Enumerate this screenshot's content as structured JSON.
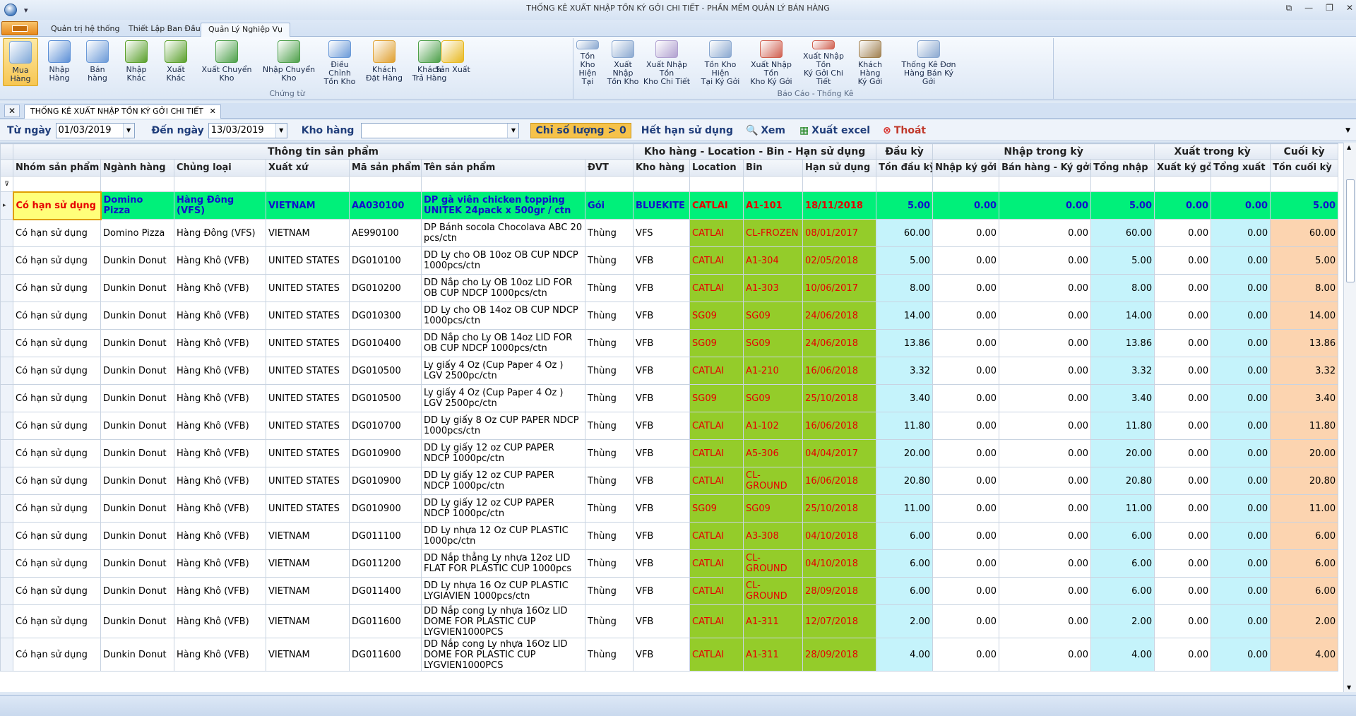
{
  "window": {
    "title": "THỐNG KÊ XUẤT NHẬP TỒN KÝ GỞI CHI TIẾT - PHẦN MỀM QUẢN LÝ BÁN HÀNG"
  },
  "ribbon_tabs": [
    "Quản trị hệ thống",
    "Thiết Lập Ban Đầu",
    "Quản Lý Nghiệp Vụ"
  ],
  "ribbon_groups": [
    {
      "label": "Chứng từ"
    },
    {
      "label": "Báo Cáo - Thống Kê"
    }
  ],
  "ribbon_buttons": [
    {
      "label": "Mua Hàng",
      "icon": "arrow-left-icon",
      "color": "#7ea7d8"
    },
    {
      "label": "Nhập Hàng",
      "icon": "arrow-down-icon",
      "color": "#5b8fd6"
    },
    {
      "label": "Bán hàng",
      "icon": "arrow-right-icon",
      "color": "#6b9ad8"
    },
    {
      "label": "Nhập Khác",
      "icon": "down-circle-icon",
      "color": "#5aa02c"
    },
    {
      "label": "Xuất Khác",
      "icon": "up-circle-icon",
      "color": "#5aa02c"
    },
    {
      "label": "Xuất Chuyển Kho",
      "icon": "refresh-icon",
      "color": "#4da04a"
    },
    {
      "label": "Nhập Chuyển Kho",
      "icon": "refresh-icon",
      "color": "#4da04a"
    },
    {
      "label": "Điều Chỉnh\nTồn Kho",
      "icon": "adjust-icon",
      "color": "#6b9ad8"
    },
    {
      "label": "Khách\nĐặt Hàng",
      "icon": "order-icon",
      "color": "#e0a030"
    },
    {
      "label": "Khách\nTrả Hàng",
      "icon": "return-icon",
      "color": "#4da04a"
    },
    {
      "label": "Sản Xuất",
      "icon": "wand-icon",
      "color": "#e8b820"
    },
    {
      "label": "Tồn Kho\nHiện Tại",
      "icon": "report-icon",
      "color": "#8aa8d0"
    },
    {
      "label": "Xuất Nhập\nTồn Kho",
      "icon": "list-icon",
      "color": "#8aa8d0"
    },
    {
      "label": "Xuất Nhập Tồn\nKho Chi Tiết",
      "icon": "grid-icon",
      "color": "#b0a0d0"
    },
    {
      "label": "Tồn Kho Hiện\nTại Ký Gởi",
      "icon": "search-doc-icon",
      "color": "#8aa8d0"
    },
    {
      "label": "Xuất Nhập Tồn\nKho Ký Gởi",
      "icon": "bar-chart-icon",
      "color": "#d06050"
    },
    {
      "label": "Xuất Nhập Tồn\nKý Gởi Chi Tiết",
      "icon": "line-chart-icon",
      "color": "#d06050"
    },
    {
      "label": "Khách Hàng\nKý Gởi",
      "icon": "customer-icon",
      "color": "#a08050"
    },
    {
      "label": "Thống Kê Đơn\nHàng Bán Ký Gởi",
      "icon": "stats-icon",
      "color": "#8aa8d0"
    }
  ],
  "doc_tab": "THỐNG KÊ XUẤT NHẬP TỒN KÝ GỞI CHI TIẾT",
  "filters": {
    "from_label": "Từ ngày",
    "from_value": "01/03/2019",
    "to_label": "Đến ngày",
    "to_value": "13/03/2019",
    "warehouse_label": "Kho hàng",
    "warehouse_value": "",
    "qty_btn": "Chỉ số lượng > 0",
    "expiry_btn": "Hết hạn sử dụng",
    "view_btn": "Xem",
    "excel_btn": "Xuất excel",
    "exit_btn": "Thoát"
  },
  "band_headers": [
    "Thông tin sản phẩm",
    "Kho hàng - Location - Bin - Hạn sử dụng",
    "Đầu kỳ",
    "Nhập trong kỳ",
    "Xuất trong kỳ",
    "Cuối kỳ"
  ],
  "columns": [
    "Nhóm sản phẩm",
    "Ngành hàng",
    "Chủng loại",
    "Xuất xứ",
    "Mã sản phẩm",
    "Tên sản phẩm",
    "ĐVT",
    "Kho hàng",
    "Location",
    "Bin",
    "Hạn sử dụng",
    "Tồn đầu kỳ",
    "Nhập ký gởi",
    "Bán hàng - Ký gởi",
    "Tổng nhập",
    "Xuất ký gởi",
    "Tổng xuất",
    "Tồn cuối kỳ"
  ],
  "rows": [
    [
      "Có hạn sử dụng",
      "Domino Pizza",
      "Hàng Đông (VFS)",
      "VIETNAM",
      "AA030100",
      "DP gà viên chicken topping UNITEK 24pack x 500gr / ctn",
      "Gói",
      "BLUEKITE",
      "CATLAI",
      "A1-101",
      "18/11/2018",
      "5.00",
      "0.00",
      "0.00",
      "5.00",
      "0.00",
      "0.00",
      "5.00"
    ],
    [
      "Có hạn sử dụng",
      "Domino Pizza",
      "Hàng Đông (VFS)",
      "VIETNAM",
      "AE990100",
      "DP Bánh socola Chocolava ABC 20 pcs/ctn",
      "Thùng",
      "VFS",
      "CATLAI",
      "CL-FROZEN",
      "08/01/2017",
      "60.00",
      "0.00",
      "0.00",
      "60.00",
      "0.00",
      "0.00",
      "60.00"
    ],
    [
      "Có hạn sử dụng",
      "Dunkin Donut",
      "Hàng Khô (VFB)",
      "UNITED STATES",
      "DG010100",
      "DD Ly cho OB 10oz OB CUP NDCP 1000pcs/ctn",
      "Thùng",
      "VFB",
      "CATLAI",
      "A1-304",
      "02/05/2018",
      "5.00",
      "0.00",
      "0.00",
      "5.00",
      "0.00",
      "0.00",
      "5.00"
    ],
    [
      "Có hạn sử dụng",
      "Dunkin Donut",
      "Hàng Khô (VFB)",
      "UNITED STATES",
      "DG010200",
      "DD Nắp cho Ly OB 10oz LID FOR OB CUP NDCP 1000pcs/ctn",
      "Thùng",
      "VFB",
      "CATLAI",
      "A1-303",
      "10/06/2017",
      "8.00",
      "0.00",
      "0.00",
      "8.00",
      "0.00",
      "0.00",
      "8.00"
    ],
    [
      "Có hạn sử dụng",
      "Dunkin Donut",
      "Hàng Khô (VFB)",
      "UNITED STATES",
      "DG010300",
      "DD Ly cho OB 14oz OB CUP NDCP 1000pcs/ctn",
      "Thùng",
      "VFB",
      "SG09",
      "SG09",
      "24/06/2018",
      "14.00",
      "0.00",
      "0.00",
      "14.00",
      "0.00",
      "0.00",
      "14.00"
    ],
    [
      "Có hạn sử dụng",
      "Dunkin Donut",
      "Hàng Khô (VFB)",
      "UNITED STATES",
      "DG010400",
      "DD Nắp cho Ly OB 14oz LID FOR OB CUP NDCP 1000pcs/ctn",
      "Thùng",
      "VFB",
      "SG09",
      "SG09",
      "24/06/2018",
      "13.86",
      "0.00",
      "0.00",
      "13.86",
      "0.00",
      "0.00",
      "13.86"
    ],
    [
      "Có hạn sử dụng",
      "Dunkin Donut",
      "Hàng Khô (VFB)",
      "UNITED STATES",
      "DG010500",
      "Ly giấy 4 Oz (Cup Paper 4 Oz ) LGV 2500pc/ctn",
      "Thùng",
      "VFB",
      "CATLAI",
      "A1-210",
      "16/06/2018",
      "3.32",
      "0.00",
      "0.00",
      "3.32",
      "0.00",
      "0.00",
      "3.32"
    ],
    [
      "Có hạn sử dụng",
      "Dunkin Donut",
      "Hàng Khô (VFB)",
      "UNITED STATES",
      "DG010500",
      "Ly giấy 4 Oz (Cup Paper 4 Oz ) LGV 2500pc/ctn",
      "Thùng",
      "VFB",
      "SG09",
      "SG09",
      "25/10/2018",
      "3.40",
      "0.00",
      "0.00",
      "3.40",
      "0.00",
      "0.00",
      "3.40"
    ],
    [
      "Có hạn sử dụng",
      "Dunkin Donut",
      "Hàng Khô (VFB)",
      "UNITED STATES",
      "DG010700",
      "DD Ly giấy 8 Oz CUP PAPER NDCP 1000pcs/ctn",
      "Thùng",
      "VFB",
      "CATLAI",
      "A1-102",
      "16/06/2018",
      "11.80",
      "0.00",
      "0.00",
      "11.80",
      "0.00",
      "0.00",
      "11.80"
    ],
    [
      "Có hạn sử dụng",
      "Dunkin Donut",
      "Hàng Khô (VFB)",
      "UNITED STATES",
      "DG010900",
      "DD Ly giấy 12 oz CUP PAPER NDCP 1000pc/ctn",
      "Thùng",
      "VFB",
      "CATLAI",
      "A5-306",
      "04/04/2017",
      "20.00",
      "0.00",
      "0.00",
      "20.00",
      "0.00",
      "0.00",
      "20.00"
    ],
    [
      "Có hạn sử dụng",
      "Dunkin Donut",
      "Hàng Khô (VFB)",
      "UNITED STATES",
      "DG010900",
      "DD Ly giấy 12 oz CUP PAPER NDCP 1000pc/ctn",
      "Thùng",
      "VFB",
      "CATLAI",
      "CL-GROUND",
      "16/06/2018",
      "20.80",
      "0.00",
      "0.00",
      "20.80",
      "0.00",
      "0.00",
      "20.80"
    ],
    [
      "Có hạn sử dụng",
      "Dunkin Donut",
      "Hàng Khô (VFB)",
      "UNITED STATES",
      "DG010900",
      "DD Ly giấy 12 oz CUP PAPER NDCP 1000pc/ctn",
      "Thùng",
      "VFB",
      "SG09",
      "SG09",
      "25/10/2018",
      "11.00",
      "0.00",
      "0.00",
      "11.00",
      "0.00",
      "0.00",
      "11.00"
    ],
    [
      "Có hạn sử dụng",
      "Dunkin Donut",
      "Hàng Khô (VFB)",
      "VIETNAM",
      "DG011100",
      "DD Ly nhựa 12 Oz CUP PLASTIC 1000pc/ctn",
      "Thùng",
      "VFB",
      "CATLAI",
      "A3-308",
      "04/10/2018",
      "6.00",
      "0.00",
      "0.00",
      "6.00",
      "0.00",
      "0.00",
      "6.00"
    ],
    [
      "Có hạn sử dụng",
      "Dunkin Donut",
      "Hàng Khô (VFB)",
      "VIETNAM",
      "DG011200",
      "DD Nắp thẳng Ly nhựa 12oz LID FLAT FOR PLASTIC CUP 1000pcs",
      "Thùng",
      "VFB",
      "CATLAI",
      "CL-GROUND",
      "04/10/2018",
      "6.00",
      "0.00",
      "0.00",
      "6.00",
      "0.00",
      "0.00",
      "6.00"
    ],
    [
      "Có hạn sử dụng",
      "Dunkin Donut",
      "Hàng Khô (VFB)",
      "VIETNAM",
      "DG011400",
      "DD Ly nhựa 16 Oz CUP PLASTIC LYGIAVIEN 1000pcs/ctn",
      "Thùng",
      "VFB",
      "CATLAI",
      "CL-GROUND",
      "28/09/2018",
      "6.00",
      "0.00",
      "0.00",
      "6.00",
      "0.00",
      "0.00",
      "6.00"
    ],
    [
      "Có hạn sử dụng",
      "Dunkin Donut",
      "Hàng Khô (VFB)",
      "VIETNAM",
      "DG011600",
      "DD Nắp cong Ly nhựa 16Oz LID DOME FOR PLASTIC CUP LYGVIEN1000PCS",
      "Thùng",
      "VFB",
      "CATLAI",
      "A1-311",
      "12/07/2018",
      "2.00",
      "0.00",
      "0.00",
      "2.00",
      "0.00",
      "0.00",
      "2.00"
    ],
    [
      "Có hạn sử dụng",
      "Dunkin Donut",
      "Hàng Khô (VFB)",
      "VIETNAM",
      "DG011600",
      "DD Nắp cong Ly nhựa 16Oz LID DOME FOR PLASTIC CUP LYGVIEN1000PCS",
      "Thùng",
      "VFB",
      "CATLAI",
      "A1-311",
      "28/09/2018",
      "4.00",
      "0.00",
      "0.00",
      "4.00",
      "0.00",
      "0.00",
      "4.00"
    ]
  ],
  "colors": {
    "selected_row": "#00f07a",
    "location": "#94cc2a",
    "cyan_col": "#c5f3fb",
    "peach_col": "#fcd4b0"
  }
}
